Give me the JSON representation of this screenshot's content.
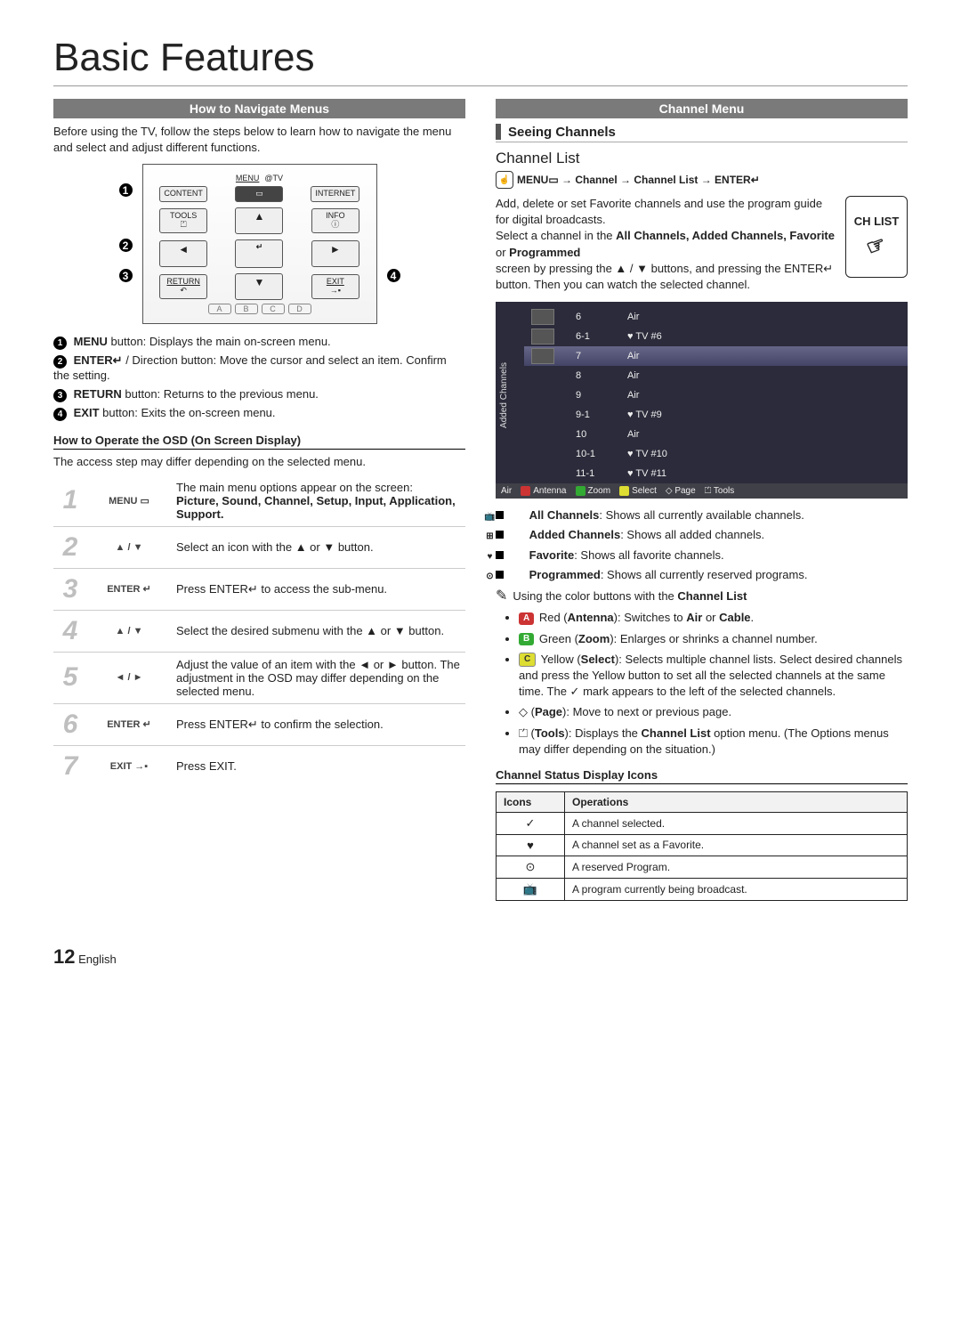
{
  "page": {
    "title": "Basic Features",
    "section_nav": "How to Navigate Menus",
    "intro": "Before using the TV, follow the steps below to learn how to navigate the menu and select and adjust different functions.",
    "section_channel": "Channel Menu",
    "page_number": "12",
    "lang": "English"
  },
  "remote": {
    "buttons": {
      "menu": "MENU",
      "tv": "@TV",
      "content": "CONTENT",
      "menuIcon": "▭",
      "internet": "INTERNET",
      "tools": "TOOLS",
      "info": "INFO",
      "up": "▲",
      "left": "◄",
      "right": "►",
      "down": "▼",
      "enter": "↵",
      "return": "RETURN",
      "returnIcon": "↶",
      "exit": "EXIT",
      "exitIcon": "→▪",
      "A": "A",
      "B": "B",
      "C": "C",
      "D": "D"
    },
    "legend": {
      "1": "MENU button: Displays the main on-screen menu.",
      "2": "ENTER↵ / Direction button: Move the cursor and select an item. Confirm the setting.",
      "3": "RETURN button: Returns to the previous menu.",
      "4": "EXIT button: Exits the on-screen menu."
    }
  },
  "osd": {
    "heading": "How to Operate the OSD (On Screen Display)",
    "note": "The access step may differ depending on the selected menu.",
    "steps": [
      {
        "n": "1",
        "key": "MENU ▭",
        "text": "The main menu options appear on the screen:",
        "bold": "Picture, Sound, Channel, Setup, Input, Application, Support."
      },
      {
        "n": "2",
        "key": "▲ / ▼",
        "text": "Select an icon with the ▲ or ▼ button."
      },
      {
        "n": "3",
        "key": "ENTER ↵",
        "text": "Press ENTER↵ to access the sub-menu."
      },
      {
        "n": "4",
        "key": "▲ / ▼",
        "text": "Select the desired submenu with the ▲ or ▼ button."
      },
      {
        "n": "5",
        "key": "◄ / ►",
        "text": "Adjust the value of an item with the ◄ or ► button. The adjustment in the OSD may differ depending on the selected menu."
      },
      {
        "n": "6",
        "key": "ENTER ↵",
        "text": "Press ENTER↵ to confirm the selection."
      },
      {
        "n": "7",
        "key": "EXIT →▪",
        "text": "Press EXIT."
      }
    ]
  },
  "channel": {
    "seeing": "Seeing Channels",
    "list_title": "Channel List",
    "path_parts": [
      "MENU▭",
      "→",
      "Channel",
      "→",
      "Channel List",
      "→",
      "ENTER↵"
    ],
    "badge": "CH LIST",
    "desc_1": "Add, delete or set Favorite channels and use the program guide for digital broadcasts.",
    "desc_2a": "Select a channel in the ",
    "desc_2b": "All Channels, Added Channels, Favorite",
    "desc_2c": " or ",
    "desc_2d": "Programmed",
    "desc_2e": " screen by pressing the ▲ / ▼ buttons, and pressing the ENTER↵ button. Then you can watch the selected channel.",
    "tv": {
      "side": "Added Channels",
      "rows": [
        {
          "thumb": true,
          "n": "6",
          "name": "Air"
        },
        {
          "thumb": true,
          "n": "6-1",
          "name": "♥ TV #6"
        },
        {
          "thumb": true,
          "n": "7",
          "name": "Air",
          "hl": true
        },
        {
          "thumb": false,
          "n": "8",
          "name": "Air"
        },
        {
          "thumb": false,
          "n": "9",
          "name": "Air"
        },
        {
          "thumb": false,
          "n": "9-1",
          "name": "♥ TV #9"
        },
        {
          "thumb": false,
          "n": "10",
          "name": "Air"
        },
        {
          "thumb": false,
          "n": "10-1",
          "name": "♥ TV #10"
        },
        {
          "thumb": false,
          "n": "11-1",
          "name": "♥ TV #11"
        }
      ],
      "footer_left": "Air",
      "footer_items": [
        {
          "cls": "sqA",
          "label": "Antenna"
        },
        {
          "cls": "sqB",
          "label": "Zoom"
        },
        {
          "cls": "sqC",
          "label": "Select"
        },
        {
          "cls": "",
          "label": "◇ Page"
        },
        {
          "cls": "",
          "label": "⏍ Tools"
        }
      ]
    },
    "legend_items": [
      {
        "icon": "📺",
        "bold": "All Channels",
        "text": ": Shows all currently available channels."
      },
      {
        "icon": "⊞",
        "bold": "Added Channels",
        "text": ": Shows all added channels."
      },
      {
        "icon": "♥",
        "bold": "Favorite",
        "text": ": Shows all favorite channels."
      },
      {
        "icon": "⊙",
        "bold": "Programmed",
        "text": ": Shows all currently reserved programs."
      }
    ],
    "color_note_lead": "✎",
    "color_note": "Using the color buttons with the ",
    "color_note_bold": "Channel List",
    "color_bullets": [
      {
        "tag": "A",
        "tagcls": "tagA",
        "label": "Red (",
        "bold": "Antenna",
        "after": "): Switches to ",
        "bold2": "Air",
        "mid": " or ",
        "bold3": "Cable",
        "end": "."
      },
      {
        "tag": "B",
        "tagcls": "tagB",
        "label": "Green (",
        "bold": "Zoom",
        "after": "): Enlarges or shrinks a channel number."
      },
      {
        "tag": "C",
        "tagcls": "tagC",
        "label": "Yellow (",
        "bold": "Select",
        "after": "): Selects multiple channel lists. Select desired channels and press the Yellow button to set all the selected channels at the same time. The ✓ mark appears to the left of the selected channels."
      },
      {
        "label": "◇ (",
        "bold": "Page",
        "after": "): Move to next or previous page."
      },
      {
        "label": "⏍ (",
        "bold": "Tools",
        "after": "): Displays the ",
        "bold2": "Channel List",
        "mid": " option menu. (The Options menus may differ depending on the situation.)"
      }
    ],
    "status_head": "Channel Status Display Icons",
    "status_table": {
      "h1": "Icons",
      "h2": "Operations",
      "rows": [
        {
          "icon": "✓",
          "op": "A channel selected."
        },
        {
          "icon": "♥",
          "op": "A channel set as a Favorite."
        },
        {
          "icon": "⊙",
          "op": "A reserved Program."
        },
        {
          "icon": "📺",
          "op": "A program currently being broadcast."
        }
      ]
    }
  }
}
